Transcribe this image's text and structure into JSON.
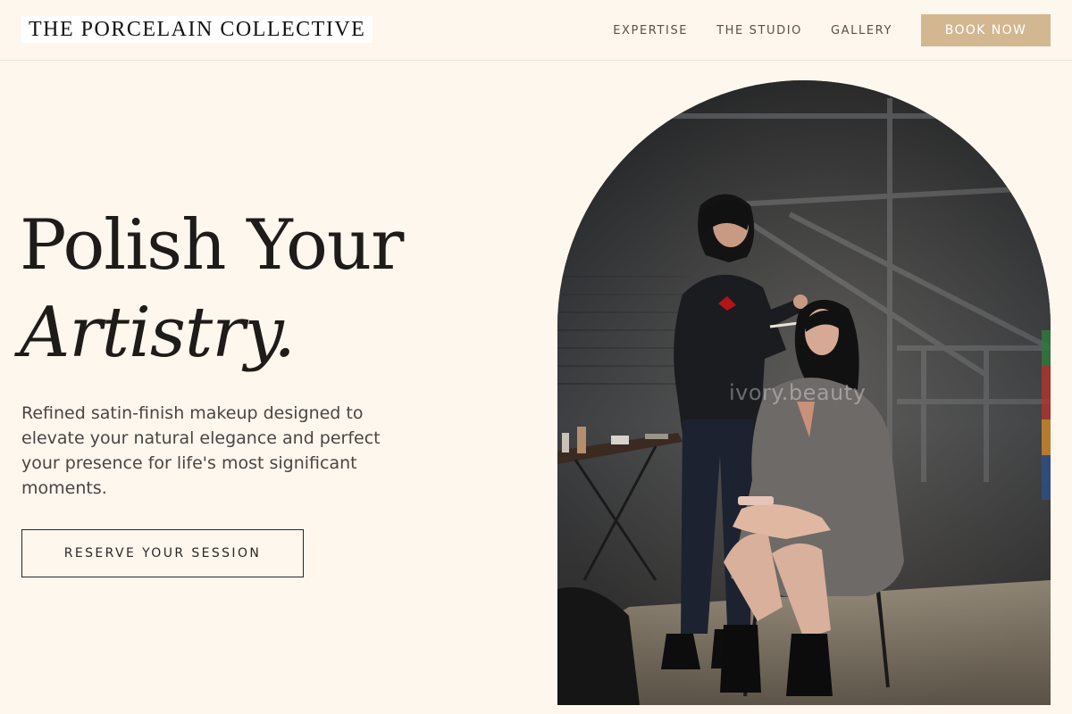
{
  "brand": {
    "name": "THE PORCELAIN COLLECTIVE"
  },
  "nav": {
    "items": [
      {
        "label": "EXPERTISE"
      },
      {
        "label": "THE STUDIO"
      },
      {
        "label": "GALLERY"
      }
    ],
    "book_label": "BOOK NOW"
  },
  "hero": {
    "title_line1": "Polish Your",
    "title_line2": "Artistry.",
    "description": "Refined satin-finish makeup designed to elevate your natural elegance and perfect your presence for life's most significant moments.",
    "cta_label": "RESERVE YOUR SESSION"
  },
  "photo": {
    "watermark": "ivory.beauty"
  },
  "colors": {
    "background": "#fdf7ee",
    "accent": "#d2b791",
    "text_dark": "#1e1b18",
    "text_body": "#4a4540"
  }
}
